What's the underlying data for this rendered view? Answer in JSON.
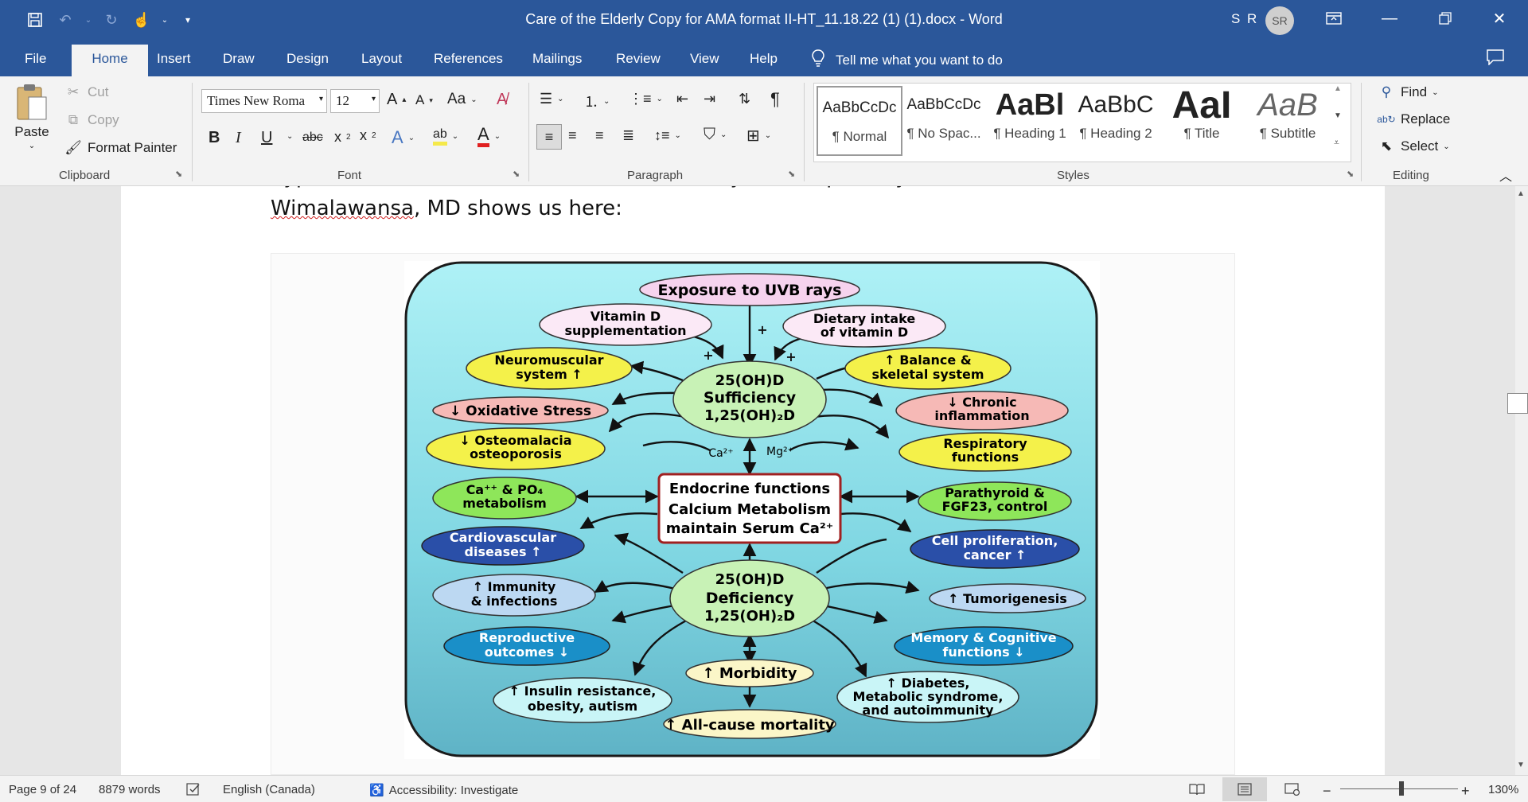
{
  "window": {
    "title": "Care of the Elderly Copy for AMA format II-HT_11.18.22 (1) (1).docx  -  Word",
    "user_initials": "S R",
    "avatar": "SR"
  },
  "menu": {
    "tabs": [
      "File",
      "Home",
      "Insert",
      "Draw",
      "Design",
      "Layout",
      "References",
      "Mailings",
      "Review",
      "View",
      "Help"
    ],
    "tell_me": "Tell me what you want to do"
  },
  "ribbon": {
    "clipboard": {
      "paste": "Paste",
      "cut": "Cut",
      "copy": "Copy",
      "format_painter": "Format Painter",
      "label": "Clipboard"
    },
    "font": {
      "name": "Times New Roma",
      "size": "12",
      "label": "Font"
    },
    "paragraph": {
      "label": "Paragraph"
    },
    "styles": {
      "label": "Styles",
      "items": [
        {
          "sample": "AaBbCcDc",
          "name": "¶ Normal"
        },
        {
          "sample": "AaBbCcDc",
          "name": "¶ No Spac..."
        },
        {
          "sample": "AaBl",
          "name": "¶ Heading 1"
        },
        {
          "sample": "AaBbC",
          "name": "¶ Heading 2"
        },
        {
          "sample": "AaI",
          "name": "¶ Title"
        },
        {
          "sample": "AaB",
          "name": "¶ Subtitle"
        }
      ]
    },
    "editing": {
      "find": "Find",
      "replace": "Replace",
      "select": "Select",
      "label": "Editing"
    }
  },
  "document": {
    "line1": "hypertension, autoimmune and inflammatory and respiratory conditions, as Sunil",
    "line2_underlined": "Wimalawansa",
    "line2_rest": ", MD shows us here:"
  },
  "figure": {
    "top": "Exposure to UVB rays",
    "vitd_supp": [
      "Vitamin D",
      "supplementation"
    ],
    "dietary": [
      "Dietary intake",
      "of vitamin D"
    ],
    "neuromuscular": [
      "Neuromuscular",
      "system ↑"
    ],
    "balance": [
      "↑ Balance &",
      "skeletal system"
    ],
    "sufficiency": [
      "25(OH)D",
      "Sufficiency",
      "1,25(OH)₂D"
    ],
    "oxidative": "↓ Oxidative Stress",
    "chronic": [
      "↓ Chronic",
      "inflammation"
    ],
    "osteomalacia": [
      "↓ Osteomalacia",
      "osteoporosis"
    ],
    "respiratory": [
      "Respiratory",
      "functions"
    ],
    "ca": "Ca²⁺",
    "mg": "Mg²⁺",
    "endocrine": [
      "Endocrine functions",
      "Calcium Metabolism",
      "maintain Serum Ca²⁺"
    ],
    "capo4": [
      "Ca⁺⁺ & PO₄",
      "metabolism"
    ],
    "parathyroid": [
      "Parathyroid &",
      "FGF23, control"
    ],
    "cardio": [
      "Cardiovascular",
      "diseases ↑"
    ],
    "cellprolif": [
      "Cell proliferation,",
      "cancer ↑"
    ],
    "immunity": [
      "↑ Immunity",
      "& infections"
    ],
    "deficiency": [
      "25(OH)D",
      "Deficiency",
      "1,25(OH)₂D"
    ],
    "tumorigenesis": "↑ Tumorigenesis",
    "reproductive": [
      "Reproductive",
      "outcomes ↓"
    ],
    "memory": [
      "Memory & Cognitive",
      "functions ↓"
    ],
    "morbidity": "↑ Morbidity",
    "insulin": [
      "↑ Insulin resistance,",
      "obesity, autism"
    ],
    "diabetes": [
      "↑ Diabetes,",
      "Metabolic syndrome,",
      "and autoimmunity"
    ],
    "mortality": "↑ All-cause mortality",
    "plus": "+"
  },
  "status": {
    "page": "Page 9 of 24",
    "words": "8879 words",
    "language": "English (Canada)",
    "accessibility": "Accessibility: Investigate",
    "zoom": "130%"
  },
  "colors": {
    "brand": "#2b579a",
    "yellow": "#f4f14a",
    "pink": "#f6b9b6",
    "green": "#8ee65a",
    "blue": "#2a4fa8",
    "lightblue": "#bcd8f2",
    "cyan": "#1a8fc8",
    "aqua": "#c9f5f7"
  }
}
